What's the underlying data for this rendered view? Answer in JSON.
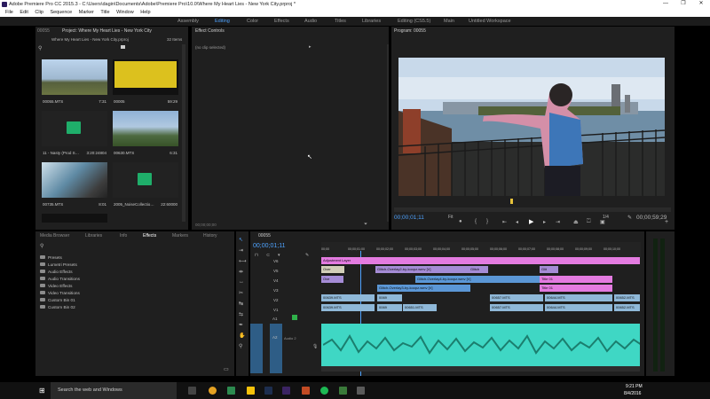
{
  "title_bar": {
    "title": "Adobe Premiere Pro CC 2015.3 - C:\\Users\\dagin\\Documents\\Adobe\\Premiere Pro\\10.0\\Where My Heart Lies - New York City.prproj *"
  },
  "window_controls": {
    "minimize": "—",
    "maximize": "❐",
    "close": "✕"
  },
  "menu": [
    "File",
    "Edit",
    "Clip",
    "Sequence",
    "Marker",
    "Title",
    "Window",
    "Help"
  ],
  "workspaces": [
    "Assembly",
    "Editing",
    "Color",
    "Effects",
    "Audio",
    "Titles",
    "Libraries",
    "Editing (CS5.5)",
    "Main",
    "Untitled Workspace"
  ],
  "workspace_active": "Editing",
  "project": {
    "tab_left": "00055",
    "tab": "Project: Where My Heart Lies - New York City",
    "name": "Where My Heart Lies - New York City.prproj",
    "count": "32 Items",
    "items": [
      {
        "name": "00055.MTS",
        "dur": "7:31"
      },
      {
        "name": "00005",
        "dur": "59:29"
      },
      {
        "name": "11 - Nasty (Prod S…",
        "dur": "3:20:24804"
      },
      {
        "name": "00630.MTS",
        "dur": "6:31"
      },
      {
        "name": "00735.MTS",
        "dur": "8:01"
      },
      {
        "name": "2005_NoiseCollectio…",
        "dur": "22:60000"
      }
    ]
  },
  "effect_controls": {
    "tab": "Effect Controls",
    "no_clip": "(no clip selected)",
    "tc": "00;00;00;00"
  },
  "program": {
    "tab": "Program: 00055",
    "current_tc": "00;00;01;11",
    "fit": "Fit",
    "ratio": "1/4",
    "duration_tc": "00;00;59;29"
  },
  "effects_panel": {
    "tabs": [
      "Media Browser",
      "Libraries",
      "Info",
      "Effects",
      "Markers",
      "History"
    ],
    "active_tab": "Effects",
    "items": [
      "Presets",
      "Lumetri Presets",
      "Audio Effects",
      "Audio Transitions",
      "Video Effects",
      "Video Transitions",
      "Custom Bin 01",
      "Custom Bin 02"
    ]
  },
  "timeline": {
    "tab": "00055",
    "current_tc": "00;00;01;11",
    "ruler": [
      "00;00",
      "00;00;01;00",
      "00;00;02;00",
      "00;00;03;00",
      "00;00;04;00",
      "00;00;05;00",
      "00;00;06;00",
      "00;00;07;00",
      "00;00;08;00",
      "00;00;09;00",
      "00;00;10;00"
    ],
    "tracks": [
      "V6",
      "V5",
      "V4",
      "V3",
      "V2",
      "V1",
      "A1",
      "A2"
    ],
    "audio_label": "Audio 2",
    "clips": {
      "v6": "Adjustment Layer",
      "v5a": "Over",
      "v5b": "Glitch-Overlay2-by-koopz.wmv [V]",
      "v5c": "Glitch",
      "v5d": "Glit",
      "v4a": "Ove",
      "v4b": "Glitch-Overlay4-by-koopz.wmv [V]",
      "v4c": "Title 01",
      "v3a": "Glitch-Overlay3-by-koopz.wmv [V]",
      "v3b": "Title 01",
      "v2a": "00639.MTS",
      "v2b": "0069",
      "v2c": "00657.MTS",
      "v2d": "00644.MTS",
      "v2e": "00652.MTS",
      "v1a": "00639.MTS",
      "v1b": "0069",
      "v1c": "00651.MTS",
      "v1d": "00657.MTS",
      "v1e": "00644.MTS",
      "v1f": "00652.MTS"
    }
  },
  "taskbar": {
    "search": "Search the web and Windows",
    "time": "9:21 PM",
    "date": "8/4/2016"
  }
}
